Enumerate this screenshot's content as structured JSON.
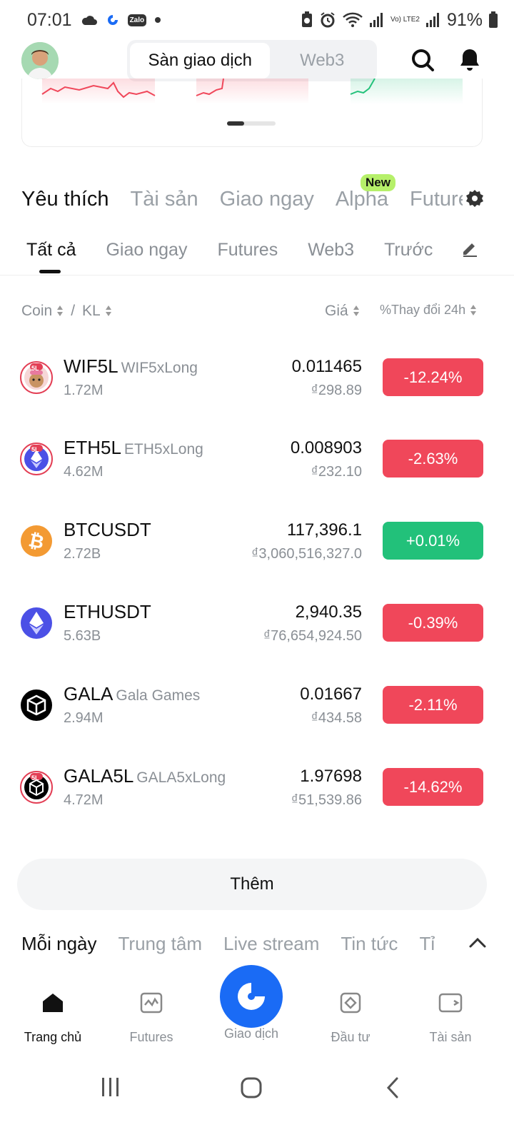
{
  "status_bar": {
    "time": "07:01",
    "battery": "91%",
    "zalo": "Zalo",
    "lte": "Vo) LTE2"
  },
  "header": {
    "segments": [
      "Sàn giao dịch",
      "Web3"
    ]
  },
  "main_tabs": {
    "items": [
      "Yêu thích",
      "Tài sản",
      "Giao ngay",
      "Alpha",
      "Futures"
    ],
    "active": "Yêu thích",
    "new_badge": "New"
  },
  "sub_tabs": {
    "items": [
      "Tất cả",
      "Giao ngay",
      "Futures",
      "Web3",
      "Trước"
    ],
    "active": "Tất cả"
  },
  "columns": {
    "coin": "Coin",
    "sep": "/",
    "volume": "KL",
    "price": "Giá",
    "change": "%Thay đổi 24h"
  },
  "rows": [
    {
      "symbol": "WIF5L",
      "full_name": "WIF5xLong",
      "volume": "1.72M",
      "price": "0.011465",
      "fiat": "₫298.89",
      "change": "-12.24%",
      "direction": "down",
      "icon_color": "#f6d7d7",
      "icon": "wif-icon",
      "badge": "5L"
    },
    {
      "symbol": "ETH5L",
      "full_name": "ETH5xLong",
      "volume": "4.62M",
      "price": "0.008903",
      "fiat": "₫232.10",
      "change": "-2.63%",
      "direction": "down",
      "icon_color": "#e9e8ff",
      "icon": "eth-icon",
      "badge": "5L"
    },
    {
      "symbol": "BTCUSDT",
      "full_name": "",
      "volume": "2.72B",
      "price": "117,396.1",
      "fiat": "₫3,060,516,327.0",
      "change": "+0.01%",
      "direction": "up",
      "icon_color": "#f39a33",
      "icon": "btc-icon",
      "badge": ""
    },
    {
      "symbol": "ETHUSDT",
      "full_name": "",
      "volume": "5.63B",
      "price": "2,940.35",
      "fiat": "₫76,654,924.50",
      "change": "-0.39%",
      "direction": "down",
      "icon_color": "#4b50e6",
      "icon": "eth-icon",
      "badge": ""
    },
    {
      "symbol": "GALA",
      "full_name": "Gala Games",
      "volume": "2.94M",
      "price": "0.01667",
      "fiat": "₫434.58",
      "change": "-2.11%",
      "direction": "down",
      "icon_color": "#000000",
      "icon": "gala-icon",
      "badge": ""
    },
    {
      "symbol": "GALA5L",
      "full_name": "GALA5xLong",
      "volume": "4.72M",
      "price": "1.97698",
      "fiat": "₫51,539.86",
      "change": "-14.62%",
      "direction": "down",
      "icon_color": "#000000",
      "icon": "gala-icon",
      "badge": "5L"
    }
  ],
  "more_button": "Thêm",
  "feed_tabs": {
    "items": [
      "Mỗi ngày",
      "Trung tâm",
      "Live stream",
      "Tin tức",
      "Tỉ"
    ],
    "active": "Mỗi ngày"
  },
  "bottom_nav": {
    "items": [
      {
        "label": "Trang chủ",
        "icon": "home-icon"
      },
      {
        "label": "Futures",
        "icon": "futures-icon"
      },
      {
        "label": "Giao dịch",
        "icon": "trade-icon"
      },
      {
        "label": "Đầu tư",
        "icon": "invest-icon"
      },
      {
        "label": "Tài sản",
        "icon": "wallet-icon"
      }
    ],
    "active": "Trang chủ"
  },
  "colors": {
    "down": "#f0475a",
    "up": "#22c17a",
    "accent": "#1a6bf5",
    "new_badge": "#b6f06a"
  }
}
